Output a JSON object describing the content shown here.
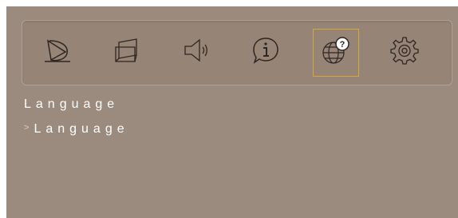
{
  "toolbar": {
    "items": [
      {
        "icon": "picture-icon",
        "active": false
      },
      {
        "icon": "screen-geometry-icon",
        "active": false
      },
      {
        "icon": "speaker-icon",
        "active": false
      },
      {
        "icon": "info-icon",
        "active": false
      },
      {
        "icon": "language-globe-icon",
        "active": true
      },
      {
        "icon": "gear-icon",
        "active": false
      }
    ],
    "active_color": "#d8a73a"
  },
  "section": {
    "title": "Language"
  },
  "menu": {
    "items": [
      {
        "label": "Language",
        "chevron": ">"
      }
    ]
  },
  "colors": {
    "panel_bg": "#9b8b7e",
    "text": "#ffffff"
  }
}
